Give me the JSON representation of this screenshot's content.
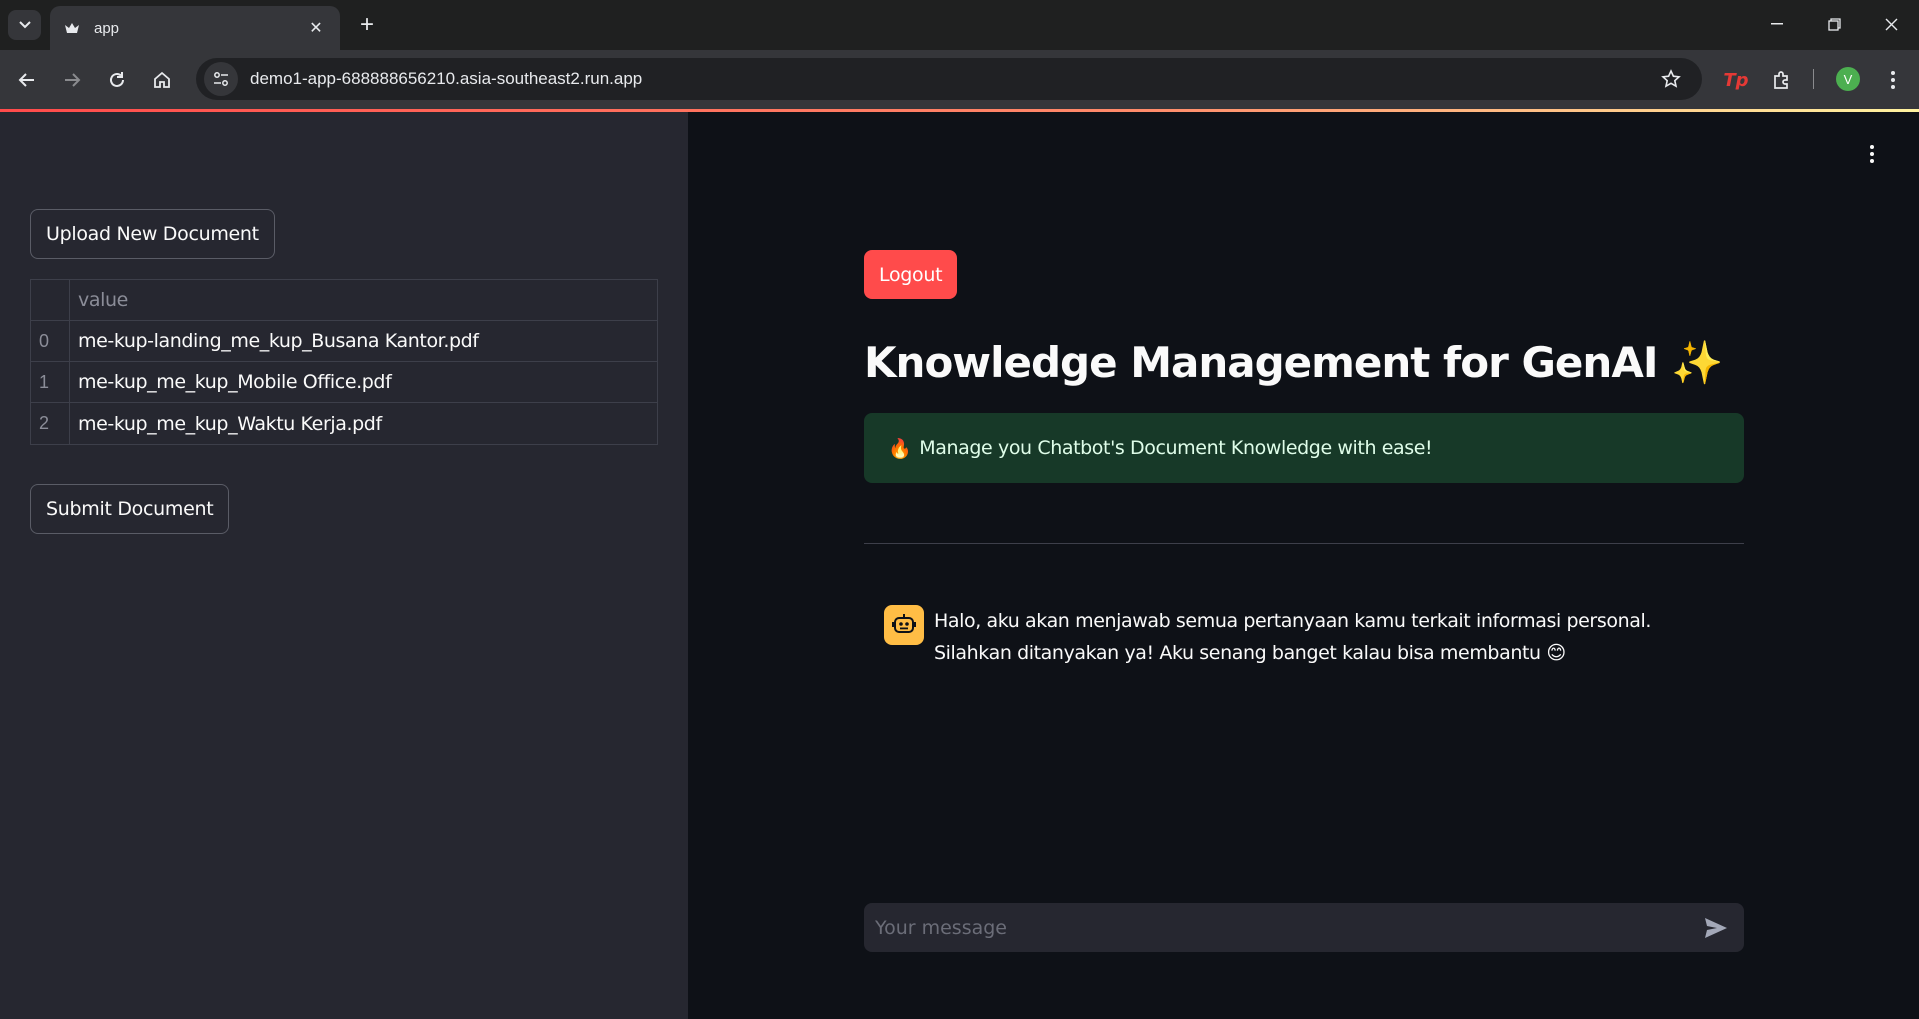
{
  "browser": {
    "tab_title": "app",
    "url": "demo1-app-688888656210.asia-southeast2.run.app",
    "profile_initial": "V"
  },
  "sidebar": {
    "upload_button": "Upload New Document",
    "table": {
      "header": "value",
      "rows": [
        {
          "index": "0",
          "value": "me-kup-landing_me_kup_Busana Kantor.pdf"
        },
        {
          "index": "1",
          "value": "me-kup_me_kup_Mobile Office.pdf"
        },
        {
          "index": "2",
          "value": "me-kup_me_kup_Waktu Kerja.pdf"
        }
      ]
    },
    "submit_button": "Submit Document"
  },
  "main": {
    "logout_button": "Logout",
    "title": "Knowledge Management for GenAI ✨",
    "alert": {
      "emoji": "🔥",
      "text": "Manage you Chatbot's Document Knowledge with ease!"
    },
    "chat": {
      "assistant_message": "Halo, aku akan menjawab semua pertanyaan kamu terkait informasi personal. Silahkan ditanyakan ya! Aku senang banget kalau bisa membantu 😊",
      "input_placeholder": "Your message"
    }
  },
  "colors": {
    "primary": "#ff4b4b",
    "sidebar_bg": "#262730",
    "main_bg": "#0e1117",
    "alert_bg": "#173928",
    "bot_avatar": "#ffbd45"
  }
}
